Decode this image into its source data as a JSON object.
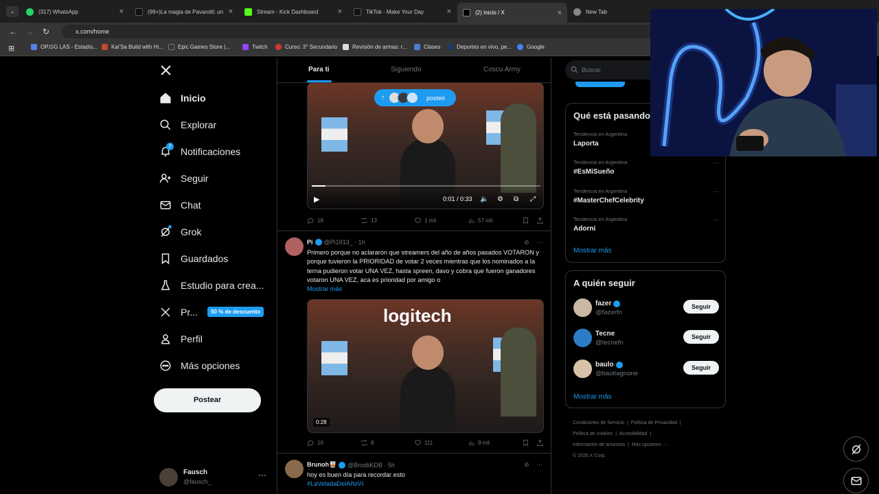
{
  "browser": {
    "tabs": [
      {
        "title": "(317) WhatsApp",
        "color": "#25d366"
      },
      {
        "title": "(99+)La magia de Pavarotti: un",
        "color": "#111111"
      },
      {
        "title": "Stream - Kick Dashboard",
        "color": "#53fc18"
      },
      {
        "title": "TikTok - Make Your Day",
        "color": "#111111"
      },
      {
        "title": "(2) Inicio / X",
        "color": "#000000"
      },
      {
        "title": "New Tab",
        "color": "#888888"
      }
    ],
    "url": "x.com/home",
    "bookmarks": [
      {
        "label": "OP.GG LAS - Estadís...",
        "color": "#5383e8"
      },
      {
        "label": "Kai'Sa Build with Hi...",
        "color": "#c04a2a"
      },
      {
        "label": "Epic Games Store |...",
        "color": "#333333"
      },
      {
        "label": "Twitch",
        "color": "#9146ff"
      },
      {
        "label": "Curso: 3° Secundario",
        "color": "#d33a2c"
      },
      {
        "label": "Revisión de armas: r...",
        "color": "#dddddd"
      },
      {
        "label": "Clases",
        "color": "#4a7fd4"
      },
      {
        "label": "Deportes en vivo, pe...",
        "color": "#1e3a6a"
      },
      {
        "label": "Google",
        "color": "#4285f4"
      }
    ]
  },
  "nav": {
    "items": [
      {
        "label": "Inicio"
      },
      {
        "label": "Explorar"
      },
      {
        "label": "Notificaciones",
        "badge": "2"
      },
      {
        "label": "Seguir"
      },
      {
        "label": "Chat"
      },
      {
        "label": "Grok"
      },
      {
        "label": "Guardados"
      },
      {
        "label": "Estudio para crea..."
      },
      {
        "label": "Pr..."
      },
      {
        "label": "Perfil"
      },
      {
        "label": "Más opciones"
      }
    ],
    "premium_badge": "50 % de descuento",
    "post_button": "Postear",
    "account": {
      "name": "Fausch",
      "handle": "@fausch_",
      "more": "···"
    }
  },
  "feed": {
    "tabs": [
      "Para ti",
      "Siguiendo",
      "Coscu Army"
    ],
    "posted_pill": "posteó",
    "video1": {
      "time": "0:01 / 0:33",
      "progress": 0.06
    },
    "tweet1_actions": {
      "replies": "18",
      "reposts": "13",
      "likes": "1 mil",
      "views": "57 mil"
    },
    "tweet2": {
      "name": "Pi",
      "handle": "@Pi1913_ · 1h",
      "text": "Primero porque no aclararon que streamers del año de años pasados VOTARON y porque tuvieron la PRIORIDAD de votar 2 veces mientras que los nominados a la terna pudieron votar UNA VEZ, hasta spreen, davo y cobra que fueron ganadores votaron UNA VEZ, aca es prioridad por amigo o",
      "show_more": "Mostrar más",
      "video_time": "0:28",
      "actions": {
        "replies": "16",
        "reposts": "8",
        "likes": "111",
        "views": "9 mil"
      }
    },
    "tweet3": {
      "name": "Brunoh🥃",
      "handle": "@BrodiiKDB · 5h",
      "text": "hoy es buen día para recordar esto",
      "hashtag": "#LaVeladaDelAñoVI"
    }
  },
  "right": {
    "search_placeholder": "Buscar",
    "trends_title": "Qué está pasando",
    "trends": [
      {
        "context": "Tendencia en Argentina",
        "name": "Laporta"
      },
      {
        "context": "Tendencia en Argentina",
        "name": "#EsMiSueño"
      },
      {
        "context": "Tendencia en Argentina",
        "name": "#MasterChefCelebrity"
      },
      {
        "context": "Tendencia en Argentina",
        "name": "Adorni"
      }
    ],
    "trends_more": "Mostrar más",
    "follow_title": "A quién seguir",
    "follow": [
      {
        "name": "fazer",
        "handle": "@fazerfn",
        "button": "Seguir"
      },
      {
        "name": "Tecne",
        "handle": "@tecnefn",
        "button": "Seguir"
      },
      {
        "name": "baulo",
        "handle": "@bautiagnone",
        "button": "Seguir"
      }
    ],
    "follow_more": "Mostrar más",
    "footer": [
      "Condiciones de Servicio",
      "Política de Privacidad",
      "Política de cookies",
      "Accesibilidad",
      "Información de anuncios",
      "Más opciones ···",
      "© 2026 X Corp."
    ]
  },
  "colors": {
    "accent": "#1d9bf0",
    "bg": "#000000",
    "text": "#e7e9ea",
    "muted": "#71767b",
    "border": "#2f3336"
  }
}
